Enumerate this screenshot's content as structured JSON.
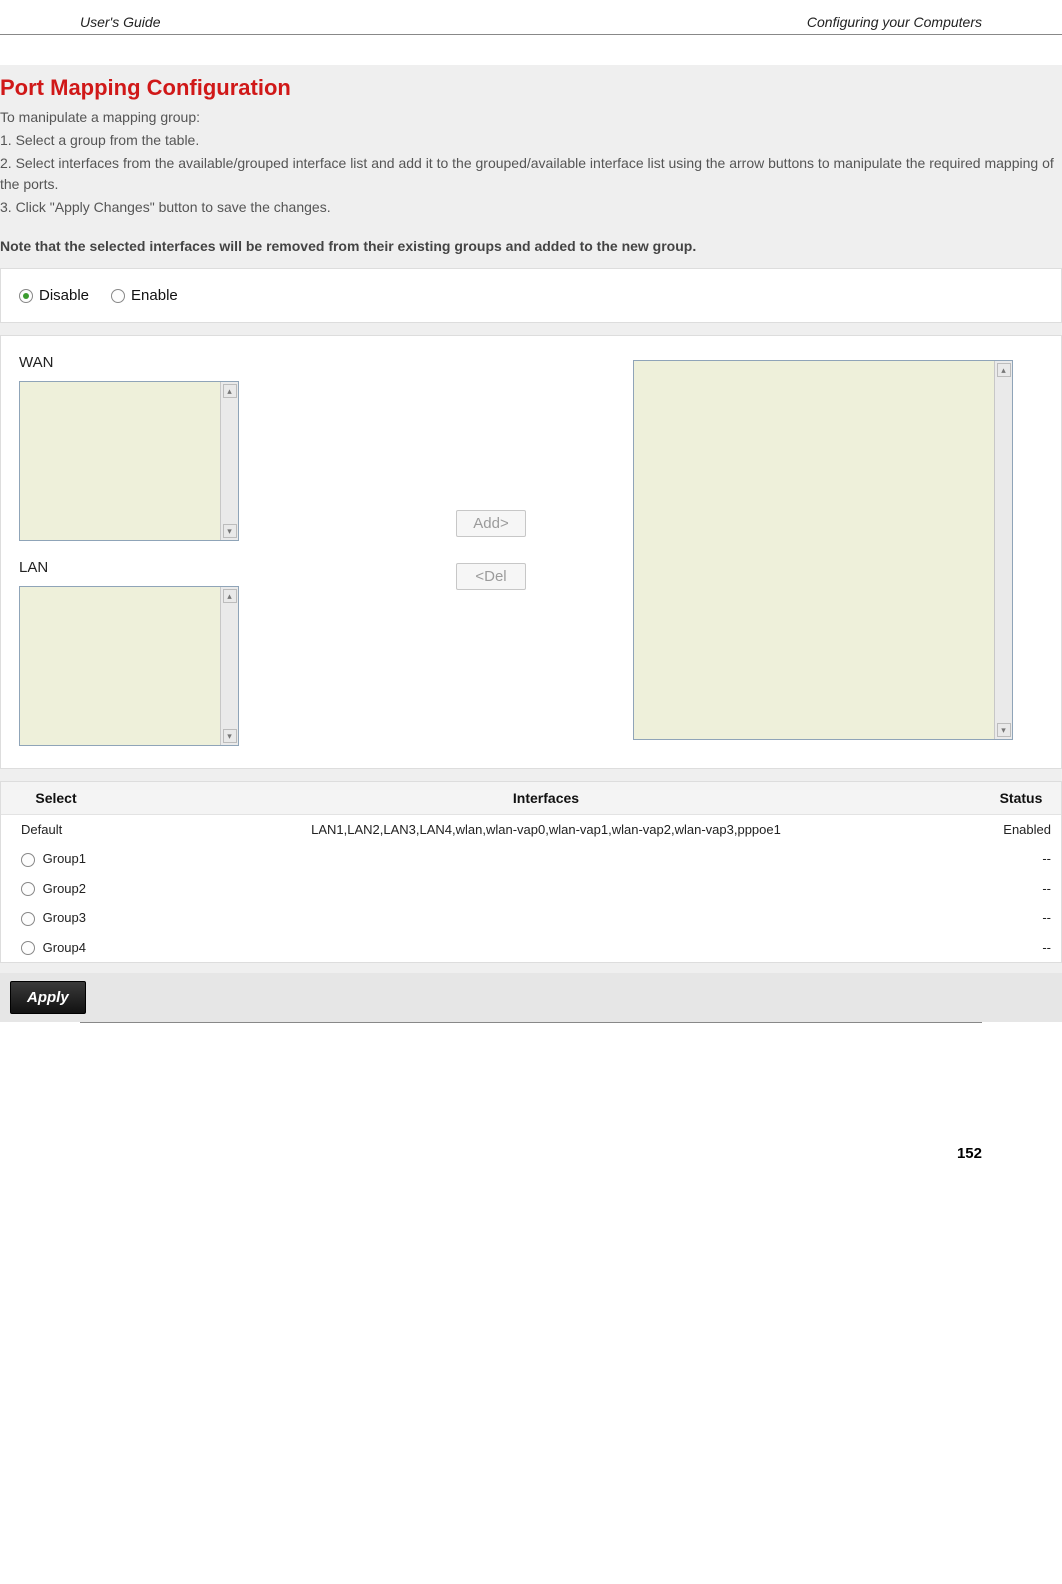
{
  "header": {
    "left": "User's Guide",
    "right": "Configuring your Computers"
  },
  "page": {
    "title": "Port Mapping Configuration",
    "intro_lead": "To manipulate a mapping group:",
    "intro_1": "1. Select a group from the table.",
    "intro_2": "2. Select interfaces from the available/grouped interface list and add it to the grouped/available interface list using the arrow buttons to manipulate the required mapping of the ports.",
    "intro_3": "3. Click \"Apply Changes\" button to save the changes.",
    "note": "Note that the selected interfaces will be removed from their existing groups and added to the new group."
  },
  "enable_radio": {
    "disable_label": "Disable",
    "enable_label": "Enable",
    "selected": "disable"
  },
  "lists": {
    "wan_label": "WAN",
    "lan_label": "LAN",
    "add_btn": "Add>",
    "del_btn": "<Del"
  },
  "table": {
    "headers": {
      "select": "Select",
      "interfaces": "Interfaces",
      "status": "Status"
    },
    "rows": [
      {
        "select": "Default",
        "radio": false,
        "interfaces": "LAN1,LAN2,LAN3,LAN4,wlan,wlan-vap0,wlan-vap1,wlan-vap2,wlan-vap3,pppoe1",
        "status": "Enabled"
      },
      {
        "select": "Group1",
        "radio": true,
        "interfaces": "",
        "status": "--"
      },
      {
        "select": "Group2",
        "radio": true,
        "interfaces": "",
        "status": "--"
      },
      {
        "select": "Group3",
        "radio": true,
        "interfaces": "",
        "status": "--"
      },
      {
        "select": "Group4",
        "radio": true,
        "interfaces": "",
        "status": "--"
      }
    ]
  },
  "apply_label": "Apply",
  "page_number": "152"
}
